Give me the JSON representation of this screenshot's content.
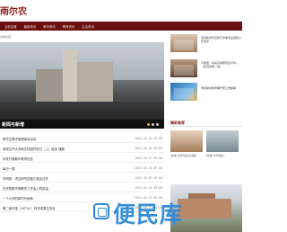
{
  "header": {
    "logo_text": "雨尔农"
  },
  "nav": {
    "items": [
      "当前位置",
      "最新资讯",
      "教学资讯",
      "教育资讯",
      "生活资讯"
    ]
  },
  "breadcrumb": "当前位置：",
  "banner": {
    "caption": "新闻与新增"
  },
  "right_list": [
    {
      "text": "浅谈新时代高校艺术类专业思政人才培养"
    },
    {
      "text": "不能发：将来高中研究生平均…（来自中国一线）"
    },
    {
      "text": "学校举办新学期开学工作部署"
    }
  ],
  "right_section": {
    "heading": "精彩推荐",
    "captions": [
      "[揭秘] 这里有最美的校园",
      "[揭秘] 新学期来了"
    ]
  },
  "news": [
    {
      "title": "研究生教学管理者培训会",
      "date": "2025-04-29 09:00"
    },
    {
      "title": "我校召开大学新生校园开放日（上）座谈 课题",
      "date": "2025-04-28 09:00"
    },
    {
      "title": "学校开展期中教学检查",
      "date": "2025-04-27 09:00"
    },
    {
      "title": "每日一题",
      "date": "2025-04-26 09:00"
    },
    {
      "title": "学研院：项目研究进度汇报会召开",
      "date": "2025-04-25 09:00"
    },
    {
      "title": "在学院新学期教学工作会上的讲话",
      "date": "2025-04-24 09:00"
    },
    {
      "title": "一个大学的新时代使命",
      "date": "2025-04-23 09:00"
    },
    {
      "title": "第二届中国（VETVC）科学成果交流会",
      "date": "2025-04-22 09:00"
    }
  ],
  "watermark": "便民库",
  "colors": {
    "brand": "#8b1a1a",
    "nav_bg": "#6a0f0f",
    "watermark": "#2d88d8"
  }
}
